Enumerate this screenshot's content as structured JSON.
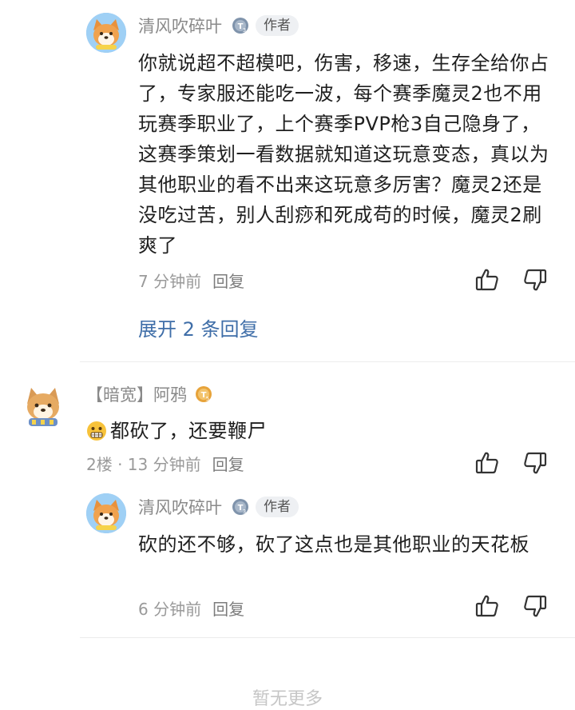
{
  "comment1": {
    "author": "清风吹碎叶",
    "badge": "作者",
    "text": "你就说超不超模吧，伤害，移速，生存全给你占了，专家服还能吃一波，每个赛季魔灵2也不用玩赛季职业了，上个赛季PVP枪3自己隐身了，这赛季策划一看数据就知道这玩意变态，真以为其他职业的看不出来这玩意多厉害？魔灵2还是没吃过苦，别人刮痧和死成苟的时候，魔灵2刷爽了",
    "time": "7 分钟前",
    "reply": "回复",
    "expand": "展开 2 条回复"
  },
  "comment2": {
    "author": "【暗宽】阿鸦",
    "text": "都砍了，还要鞭尸",
    "floor_time": "2楼 · 13 分钟前",
    "reply": "回复"
  },
  "comment3": {
    "author": "清风吹碎叶",
    "badge": "作者",
    "text": "砍的还不够，砍了这点也是其他职业的天花板",
    "time": "6 分钟前",
    "reply": "回复"
  },
  "footer": {
    "text": "暂无更多"
  },
  "icons": {
    "like": "thumbs-up-outline",
    "dislike": "thumbs-down-outline",
    "level_badge_1": "T3",
    "level_badge_2": "T5"
  },
  "colors": {
    "link": "#3f6ea8",
    "meta": "#9a9a9a",
    "level_t3": "#7f93ab",
    "level_t5": "#e7a33a"
  }
}
